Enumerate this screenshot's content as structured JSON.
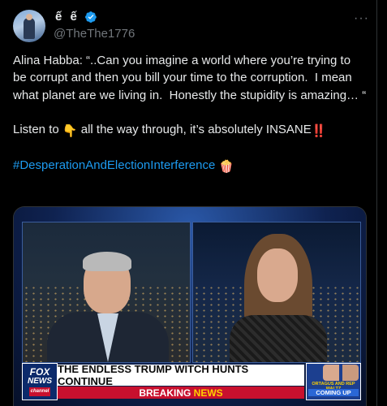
{
  "author": {
    "display_name": "ế ế",
    "handle": "@TheThe1776",
    "avatar_icon": "avatar-image",
    "verified_icon": "verified-badge-icon"
  },
  "more_label": "···",
  "post": {
    "line1": "Alina Habba: “..Can you imagine a world where you’re trying to be corrupt and then you bill your time to the corruption.  I mean what planet are we living in.  Honestly the stupidity is amazing… “",
    "line2_before": "Listen to ",
    "line2_emoji": "👇",
    "line2_after": " all the way through, it’s absolutely INSANE",
    "line2_emoji2": "‼️",
    "hashtag": "#DesperationAndElectionInterference",
    "hashtag_emoji": "🍿"
  },
  "video": {
    "network": "FOX",
    "network_sub": "NEWS",
    "network_channel": "channel",
    "headline": "THE ENDLESS TRUMP WITCH HUNTS CONTINUE",
    "breaking_a": "BREAKING ",
    "breaking_b": "NEWS",
    "promo_small": "ORTAGUS AND REP WALTZ",
    "promo_coming": "COMING UP"
  },
  "colors": {
    "background": "#000000",
    "text": "#e7e9ea",
    "muted": "#71767b",
    "link": "#1d9bf0",
    "verified": "#1d9bf0",
    "fox_red": "#c8102e",
    "fox_blue": "#0c2a6b"
  }
}
